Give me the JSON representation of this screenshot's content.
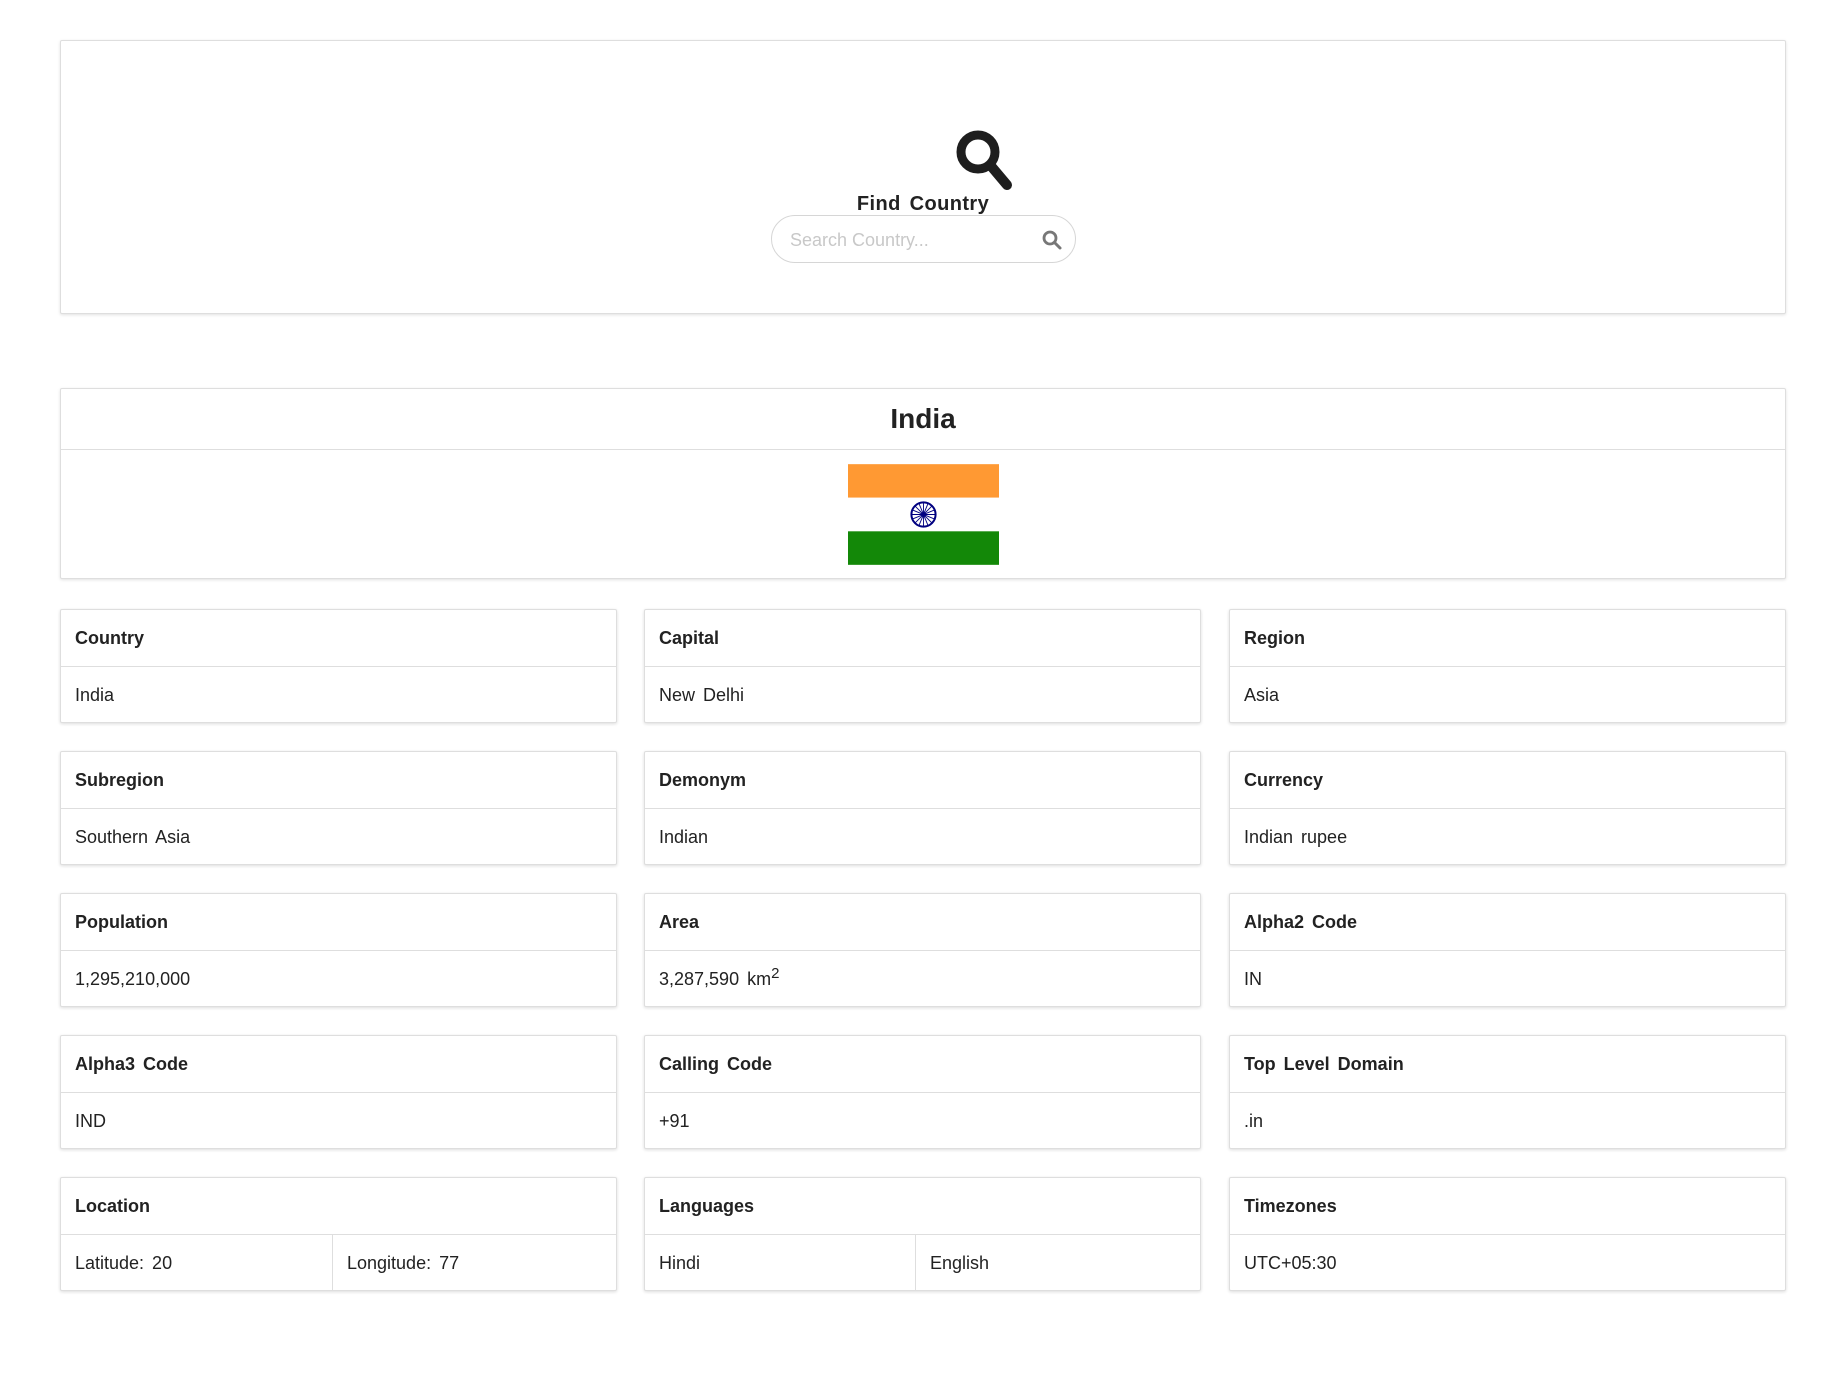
{
  "search": {
    "title": "Find Country",
    "placeholder": "Search Country...",
    "value": ""
  },
  "country": {
    "name": "India",
    "flag_colors": {
      "saffron": "#FF9933",
      "white": "#FFFFFF",
      "green": "#138808",
      "chakra": "#000080"
    }
  },
  "details": {
    "country": {
      "label": "Country",
      "value": "India"
    },
    "capital": {
      "label": "Capital",
      "value": "New Delhi"
    },
    "region": {
      "label": "Region",
      "value": "Asia"
    },
    "subregion": {
      "label": "Subregion",
      "value": "Southern Asia"
    },
    "demonym": {
      "label": "Demonym",
      "value": "Indian"
    },
    "currency": {
      "label": "Currency",
      "value": "Indian rupee"
    },
    "population": {
      "label": "Population",
      "value": "1,295,210,000"
    },
    "area": {
      "label": "Area",
      "value": "3,287,590",
      "unit": "km",
      "unit_sup": "2"
    },
    "alpha2": {
      "label": "Alpha2 Code",
      "value": "IN"
    },
    "alpha3": {
      "label": "Alpha3 Code",
      "value": "IND"
    },
    "calling_code": {
      "label": "Calling Code",
      "value": "+91"
    },
    "tld": {
      "label": "Top Level Domain",
      "value": ".in"
    },
    "location": {
      "label": "Location",
      "latitude": "Latitude: 20",
      "longitude": "Longitude: 77"
    },
    "languages": {
      "label": "Languages",
      "items": [
        "Hindi",
        "English"
      ]
    },
    "timezones": {
      "label": "Timezones",
      "value": "UTC+05:30"
    }
  }
}
